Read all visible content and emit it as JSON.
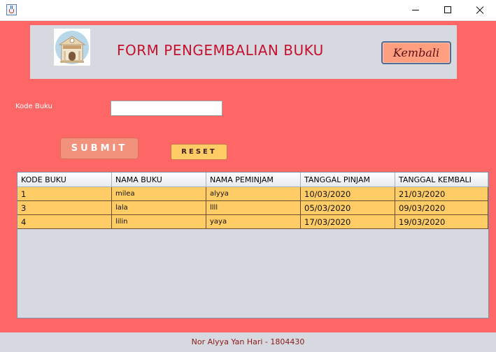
{
  "header": {
    "title": "FORM PENGEMBALIAN BUKU",
    "back_button": "Kembali",
    "logo_text": "LIBRARY"
  },
  "form": {
    "kode_label": "Kode Buku",
    "kode_value": "",
    "submit_label": "SUBMIT",
    "reset_label": "RESET"
  },
  "table": {
    "columns": [
      "KODE BUKU",
      "NAMA BUKU",
      "NAMA PEMINJAM",
      "TANGGAL PINJAM",
      "TANGGAL KEMBALI"
    ],
    "rows": [
      [
        "1",
        "milea",
        "alyya",
        "10/03/2020",
        "21/03/2020"
      ],
      [
        "3",
        "lala",
        "llll",
        "05/03/2020",
        "09/03/2020"
      ],
      [
        "4",
        "lilin",
        "yaya",
        "17/03/2020",
        "19/03/2020"
      ]
    ]
  },
  "footer": {
    "text": "Nor Alyya Yan Hari - 1804430"
  },
  "colors": {
    "background": "#ff6666",
    "panel": "#d6d9e0",
    "title": "#c8102e",
    "row": "#ffcc66"
  }
}
